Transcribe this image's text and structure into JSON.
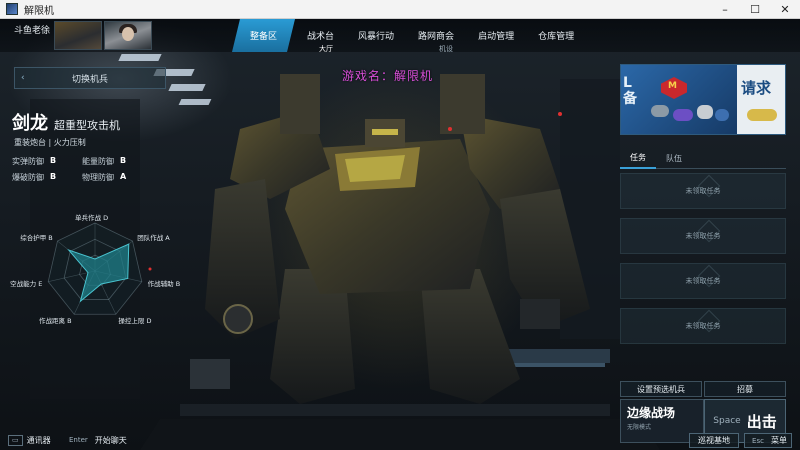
{
  "window": {
    "title": "解限机",
    "min": "–",
    "max": "☐",
    "close": "✕"
  },
  "topbar": {
    "player_name": "斗鱼老徐",
    "nav_tabs": [
      {
        "label": "整备区",
        "active": true
      },
      {
        "label": "战术台",
        "active": false
      },
      {
        "label": "风暴行动",
        "active": false
      },
      {
        "label": "路网商会",
        "active": false
      },
      {
        "label": "启动管理",
        "active": false
      },
      {
        "label": "仓库管理",
        "active": false
      }
    ],
    "sub_tabs": [
      {
        "label": "大厅",
        "active": true
      },
      {
        "label": "",
        "active": false
      },
      {
        "label": "机设",
        "active": false
      },
      {
        "label": "",
        "active": false
      }
    ]
  },
  "overlay_title": "游戏名：解限机",
  "left_panel": {
    "switch_label": "切换机兵",
    "mech_name": "剑龙",
    "mech_class": "超重型攻击机",
    "tags": "重装炮台 | 火力压制",
    "defense": [
      {
        "name": "实弹防御",
        "grade": "B"
      },
      {
        "name": "能量防御",
        "grade": "B"
      },
      {
        "name": "爆破防御",
        "grade": "B"
      },
      {
        "name": "物理防御",
        "grade": "A"
      }
    ],
    "radar": {
      "axes": [
        {
          "label": "单兵作战 D",
          "value": 0.25
        },
        {
          "label": "团队作战 A",
          "value": 0.9
        },
        {
          "label": "作战辅助 B",
          "value": 0.7
        },
        {
          "label": "操控上限 D",
          "value": 0.3
        },
        {
          "label": "作战距离 B",
          "value": 0.7
        },
        {
          "label": "空战能力 E",
          "value": 0.15
        },
        {
          "label": "综合护甲 B",
          "value": 0.7
        }
      ]
    }
  },
  "right_panel": {
    "banner": {
      "edge_text": "L\n备",
      "logo_text": "M",
      "cta": "请求"
    },
    "tabs": [
      {
        "label": "任务",
        "active": true
      },
      {
        "label": "队伍",
        "active": false
      }
    ],
    "tasks": [
      {
        "label": "未领取任务"
      },
      {
        "label": "未领取任务"
      },
      {
        "label": "未领取任务"
      },
      {
        "label": "未领取任务"
      }
    ],
    "preset_label": "设置预选机兵",
    "recruit_label": "招募",
    "mode_name": "边缘战场",
    "mode_sub": "无限模式",
    "start_key": "Space",
    "start_label": "出击"
  },
  "bottom": {
    "comms_key": "▭",
    "comms_label": "通讯器",
    "chat_key": "Enter",
    "chat_label": "开始聊天",
    "patrol_label": "巡视基地",
    "menu_key": "Esc",
    "menu_label": "菜单"
  },
  "colors": {
    "accent": "#2a9bd4",
    "radar_fill": "#1f7f8a",
    "overlay_text": "#d84fd8"
  }
}
